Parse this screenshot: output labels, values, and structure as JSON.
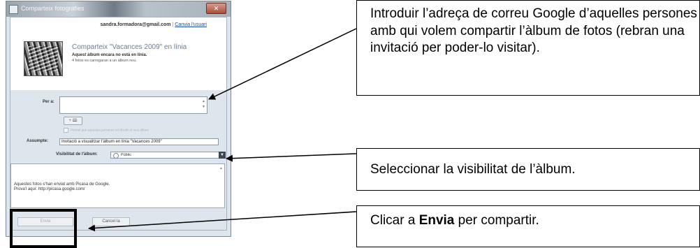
{
  "dialog": {
    "title": "Comparteix fotografies",
    "close_symbol": "✕",
    "account": {
      "email": "sandra.formadora@gmail.com",
      "separator": "|",
      "switch_user": "Canvia l'usuari"
    },
    "album": {
      "title": "Comparteix \"Vacances 2009\" en línia",
      "status": "Aquest àlbum encara no està en línia.",
      "note": "4 fotos es carregaran a un àlbum nou."
    },
    "to": {
      "label": "Per a:",
      "value": ""
    },
    "add_contact_label": "+ 🕮",
    "permission_checkbox_label": "Permet que aquestes persones vol bloclin el meu àlbum",
    "subject": {
      "label": "Assumpte:",
      "value": "Invitació a visualitzar l'àlbum en línia \"Vacances 2009\""
    },
    "visibility": {
      "label": "Visibilitat de l'àlbum:",
      "selected": "Públic",
      "dropdown_icon": "chevron-down-icon"
    },
    "message": {
      "line1": "Aquestes fotos s'han enviat amb Picasa de Google.",
      "line2": "Prova'l aquí: http://picasa.google.com/"
    },
    "buttons": {
      "send": "Envia",
      "cancel": "Cancel·la"
    }
  },
  "callouts": {
    "email_instruction": "Introduir l’adreça de correu Google d’aquelles persones amb qui volem compartir l’àlbum de fotos (rebran una invitació per poder-lo visitar).",
    "visibility_instruction": "Seleccionar la visibilitat de l’àlbum.",
    "send_instruction_prefix": "Clicar a ",
    "send_instruction_bold": "Envia",
    "send_instruction_suffix": " per compartir."
  }
}
